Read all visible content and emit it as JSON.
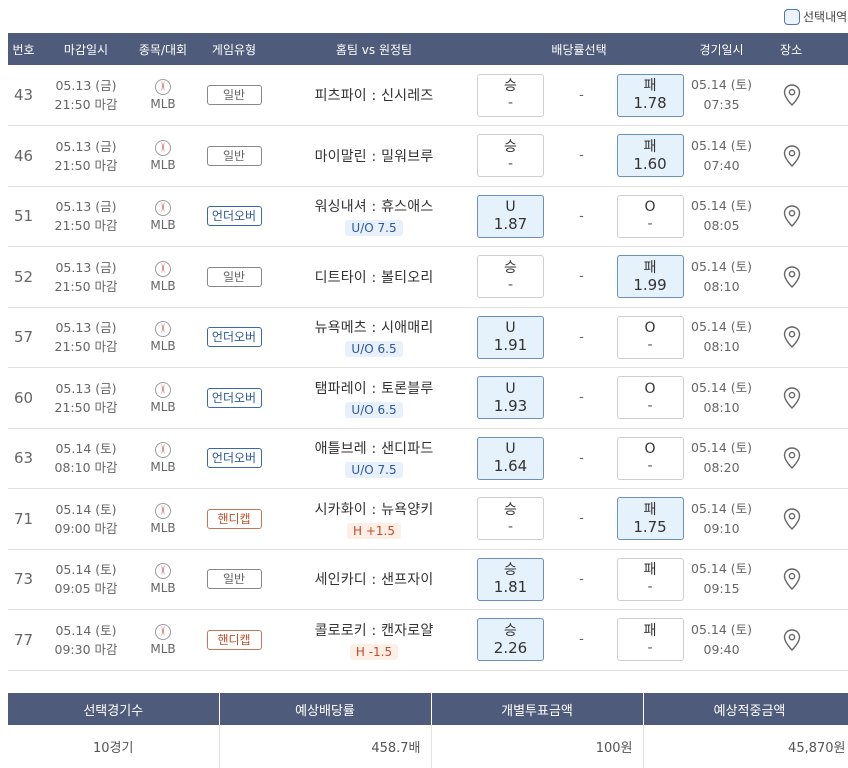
{
  "top_toggle_label": "선택내역",
  "headers": [
    "번호",
    "마감일시",
    "종목/대회",
    "게임유형",
    "홈팀 vs 원정팀",
    "배당률선택",
    "경기일시",
    "장소"
  ],
  "rows": [
    {
      "no": "43",
      "deadline_date": "05.13 (금)",
      "deadline_time": "21:50 마감",
      "league": "MLB",
      "type": "일반",
      "match": "피츠파이 : 신시레즈",
      "sub": "",
      "left_label": "승",
      "left_odds": "-",
      "draw": "-",
      "right_label": "패",
      "right_odds": "1.78",
      "selected": "right",
      "game_date": "05.14 (토)",
      "game_time": "07:35"
    },
    {
      "no": "46",
      "deadline_date": "05.13 (금)",
      "deadline_time": "21:50 마감",
      "league": "MLB",
      "type": "일반",
      "match": "마이말린 : 밀워브루",
      "sub": "",
      "left_label": "승",
      "left_odds": "-",
      "draw": "-",
      "right_label": "패",
      "right_odds": "1.60",
      "selected": "right",
      "game_date": "05.14 (토)",
      "game_time": "07:40"
    },
    {
      "no": "51",
      "deadline_date": "05.13 (금)",
      "deadline_time": "21:50 마감",
      "league": "MLB",
      "type": "언더오버",
      "match": "워싱내셔 : 휴스애스",
      "sub": "U/O 7.5",
      "left_label": "U",
      "left_odds": "1.87",
      "draw": "-",
      "right_label": "O",
      "right_odds": "-",
      "selected": "left",
      "game_date": "05.14 (토)",
      "game_time": "08:05"
    },
    {
      "no": "52",
      "deadline_date": "05.13 (금)",
      "deadline_time": "21:50 마감",
      "league": "MLB",
      "type": "일반",
      "match": "디트타이 : 볼티오리",
      "sub": "",
      "left_label": "승",
      "left_odds": "-",
      "draw": "-",
      "right_label": "패",
      "right_odds": "1.99",
      "selected": "right",
      "game_date": "05.14 (토)",
      "game_time": "08:10"
    },
    {
      "no": "57",
      "deadline_date": "05.13 (금)",
      "deadline_time": "21:50 마감",
      "league": "MLB",
      "type": "언더오버",
      "match": "뉴욕메츠 : 시애매리",
      "sub": "U/O 6.5",
      "left_label": "U",
      "left_odds": "1.91",
      "draw": "-",
      "right_label": "O",
      "right_odds": "-",
      "selected": "left",
      "game_date": "05.14 (토)",
      "game_time": "08:10"
    },
    {
      "no": "60",
      "deadline_date": "05.13 (금)",
      "deadline_time": "21:50 마감",
      "league": "MLB",
      "type": "언더오버",
      "match": "탬파레이 : 토론블루",
      "sub": "U/O 6.5",
      "left_label": "U",
      "left_odds": "1.93",
      "draw": "-",
      "right_label": "O",
      "right_odds": "-",
      "selected": "left",
      "game_date": "05.14 (토)",
      "game_time": "08:10"
    },
    {
      "no": "63",
      "deadline_date": "05.14 (토)",
      "deadline_time": "08:10 마감",
      "league": "MLB",
      "type": "언더오버",
      "match": "애틀브레 : 샌디파드",
      "sub": "U/O 7.5",
      "left_label": "U",
      "left_odds": "1.64",
      "draw": "-",
      "right_label": "O",
      "right_odds": "-",
      "selected": "left",
      "game_date": "05.14 (토)",
      "game_time": "08:20"
    },
    {
      "no": "71",
      "deadline_date": "05.14 (토)",
      "deadline_time": "09:00 마감",
      "league": "MLB",
      "type": "핸디캡",
      "match": "시카화이 : 뉴욕양키",
      "sub": "H +1.5",
      "left_label": "승",
      "left_odds": "-",
      "draw": "-",
      "right_label": "패",
      "right_odds": "1.75",
      "selected": "right",
      "game_date": "05.14 (토)",
      "game_time": "09:10"
    },
    {
      "no": "73",
      "deadline_date": "05.14 (토)",
      "deadline_time": "09:05 마감",
      "league": "MLB",
      "type": "일반",
      "match": "세인카디 : 샌프자이",
      "sub": "",
      "left_label": "승",
      "left_odds": "1.81",
      "draw": "-",
      "right_label": "패",
      "right_odds": "-",
      "selected": "left",
      "game_date": "05.14 (토)",
      "game_time": "09:15"
    },
    {
      "no": "77",
      "deadline_date": "05.14 (토)",
      "deadline_time": "09:30 마감",
      "league": "MLB",
      "type": "핸디캡",
      "match": "콜로로키 : 캔자로얄",
      "sub": "H -1.5",
      "left_label": "승",
      "left_odds": "2.26",
      "draw": "-",
      "right_label": "패",
      "right_odds": "-",
      "selected": "left",
      "game_date": "05.14 (토)",
      "game_time": "09:40"
    }
  ],
  "summary": {
    "headers": [
      "선택경기수",
      "예상배당률",
      "개별투표금액",
      "예상적중금액"
    ],
    "values": [
      "10경기",
      "458.7배",
      "100원",
      "45,870원"
    ]
  },
  "colors": {
    "header_bg": "#4f5b7a",
    "selected_bg": "#e5f1fb",
    "ou": "#2b5a9e",
    "handicap": "#c0502a"
  },
  "icons": {
    "sport": "baseball-icon",
    "venue": "map-pin-icon"
  }
}
